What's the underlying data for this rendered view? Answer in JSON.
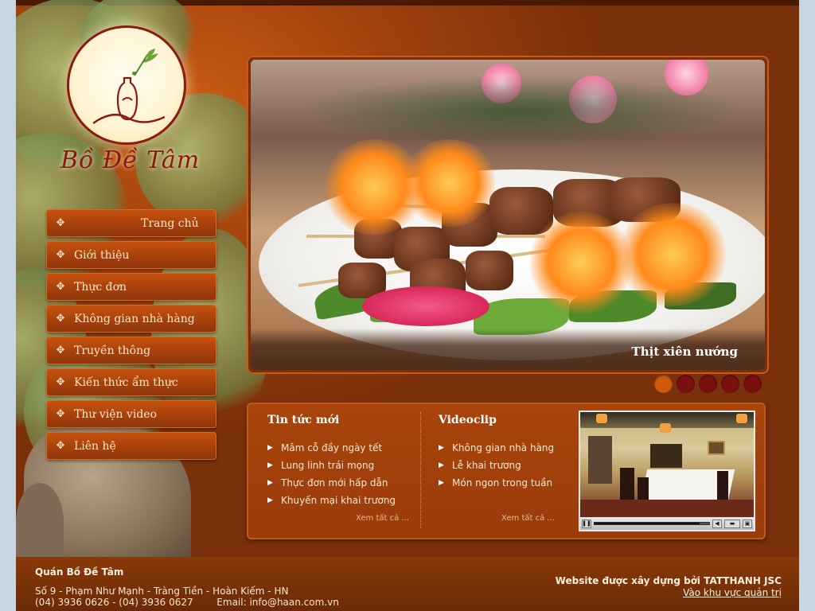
{
  "brand": {
    "name": "Bồ Đề Tâm",
    "logo_icon": "vase-with-bamboo-logo"
  },
  "menu": [
    {
      "label": "Trang chủ",
      "icon": "diamond-dots-icon",
      "active": true
    },
    {
      "label": "Giới thiệu",
      "icon": "diamond-dots-icon"
    },
    {
      "label": "Thực đơn",
      "icon": "diamond-dots-icon"
    },
    {
      "label": "Không gian nhà hàng",
      "icon": "diamond-dots-icon"
    },
    {
      "label": "Truyền thông",
      "icon": "diamond-dots-icon"
    },
    {
      "label": "Kiến thức ẩm thực",
      "icon": "diamond-dots-icon"
    },
    {
      "label": "Thư viện video",
      "icon": "diamond-dots-icon"
    },
    {
      "label": "Liên hệ",
      "icon": "diamond-dots-icon"
    }
  ],
  "slider": {
    "caption": "Thịt xiên nướng",
    "dot_count": 5,
    "active_dot": 0
  },
  "news": {
    "title": "Tin tức mới",
    "items": [
      "Mâm cỗ đầy ngày tết",
      "Lung linh trái mọng",
      "Thực đơn mới hấp dẫn",
      "Khuyến mại khai trương"
    ],
    "see_all": "Xem tất cả ..."
  },
  "videoclip": {
    "title": "Videoclip",
    "items": [
      "Không gian nhà hàng",
      "Lễ khai trương",
      "Món ngon trong tuần"
    ],
    "see_all": "Xem tất cả ..."
  },
  "video_player": {
    "progress": 0.92
  },
  "footer": {
    "name": "Quán Bồ Đề Tâm",
    "address": "Số 9 - Phạm Như Mạnh - Tràng Tiền - Hoàn Kiếm - HN",
    "phone": "(04) 3936 0626 - (04) 3936 0627",
    "email": "Email: info@haan.com.vn",
    "built_by": "Website được xây dựng bởi TATTHANH JSC",
    "admin_link": "Vào khu vực quản trị"
  },
  "colors": {
    "accent": "#c6520f",
    "background": "#6b2a08",
    "active_dot": "#d0580f",
    "dot": "#7a0f0f"
  }
}
